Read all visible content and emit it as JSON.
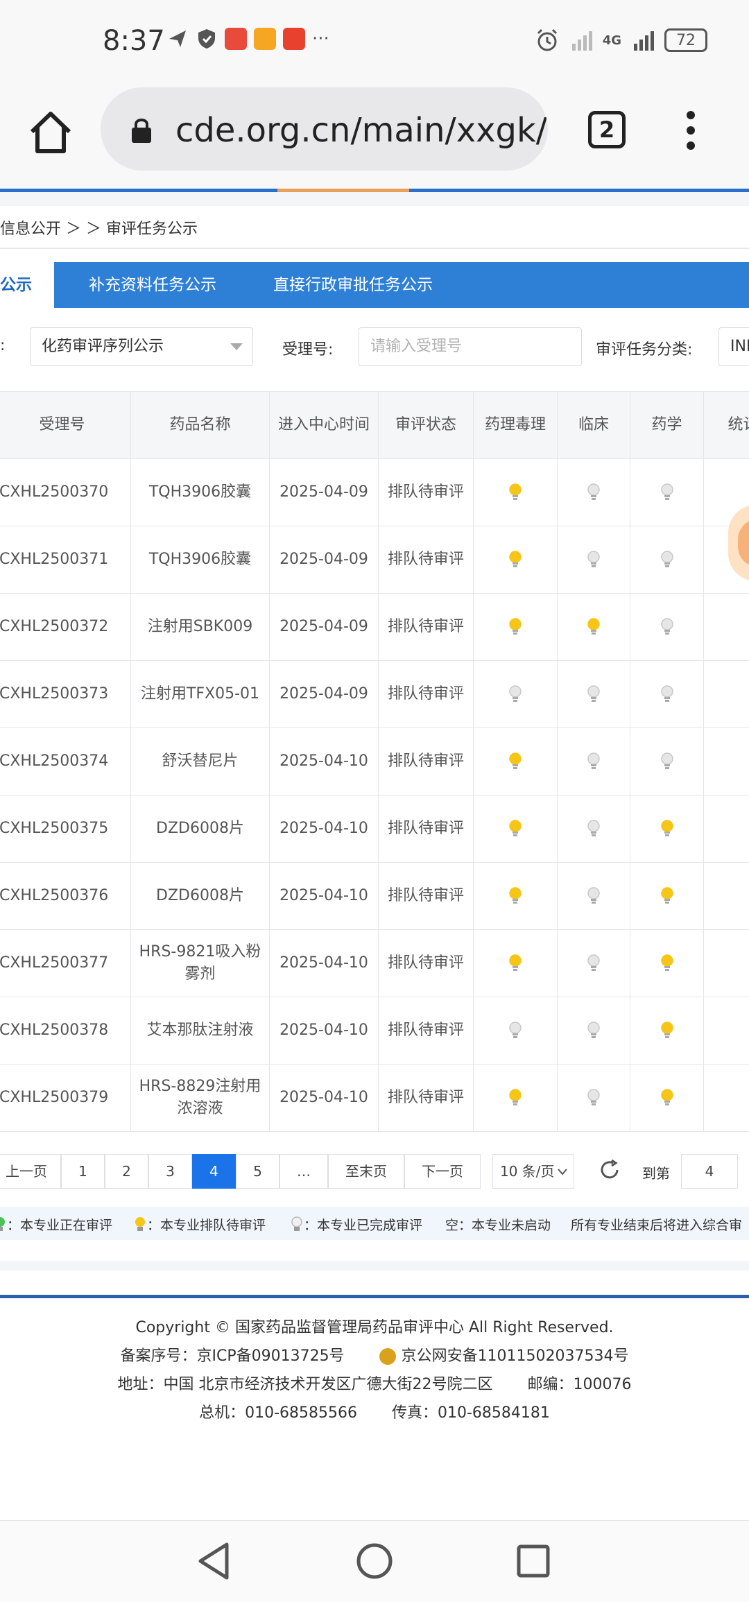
{
  "status": {
    "time": "8:37",
    "network": "4G",
    "battery": "72",
    "more": "···"
  },
  "browser": {
    "url": "cde.org.cn/main/xxgk/lis",
    "tab_count": "2"
  },
  "breadcrumb": "信息公开 ＞ ＞ 审评任务公示",
  "tabs": [
    {
      "label": "公示"
    },
    {
      "label": "补充资料任务公示"
    },
    {
      "label": "直接行政审批任务公示"
    }
  ],
  "filters": {
    "category_label": ":",
    "category_value": "化药审评序列公示",
    "accept_label": "受理号:",
    "accept_placeholder": "请输入受理号",
    "task_label": "审评任务分类:",
    "task_value": "INI"
  },
  "table": {
    "headers": [
      "受理号",
      "药品名称",
      "进入中心时间",
      "审评状态",
      "药理毒理",
      "临床",
      "药学",
      "统计"
    ],
    "rows": [
      {
        "id": "CXHL2500370",
        "name": "TQH3906胶囊",
        "date": "2025-04-09",
        "status": "排队待审评",
        "pharm": "yellow",
        "clinical": "white",
        "pharmacy": "white"
      },
      {
        "id": "CXHL2500371",
        "name": "TQH3906胶囊",
        "date": "2025-04-09",
        "status": "排队待审评",
        "pharm": "yellow",
        "clinical": "white",
        "pharmacy": "white"
      },
      {
        "id": "CXHL2500372",
        "name": "注射用SBK009",
        "date": "2025-04-09",
        "status": "排队待审评",
        "pharm": "yellow",
        "clinical": "yellow",
        "pharmacy": "white"
      },
      {
        "id": "CXHL2500373",
        "name": "注射用TFX05-01",
        "date": "2025-04-09",
        "status": "排队待审评",
        "pharm": "white",
        "clinical": "white",
        "pharmacy": "white"
      },
      {
        "id": "CXHL2500374",
        "name": "舒沃替尼片",
        "date": "2025-04-10",
        "status": "排队待审评",
        "pharm": "yellow",
        "clinical": "white",
        "pharmacy": "white"
      },
      {
        "id": "CXHL2500375",
        "name": "DZD6008片",
        "date": "2025-04-10",
        "status": "排队待审评",
        "pharm": "yellow",
        "clinical": "white",
        "pharmacy": "yellow"
      },
      {
        "id": "CXHL2500376",
        "name": "DZD6008片",
        "date": "2025-04-10",
        "status": "排队待审评",
        "pharm": "yellow",
        "clinical": "white",
        "pharmacy": "yellow"
      },
      {
        "id": "CXHL2500377",
        "name": "HRS-9821吸入粉雾剂",
        "date": "2025-04-10",
        "status": "排队待审评",
        "pharm": "yellow",
        "clinical": "white",
        "pharmacy": "yellow"
      },
      {
        "id": "CXHL2500378",
        "name": "艾本那肽注射液",
        "date": "2025-04-10",
        "status": "排队待审评",
        "pharm": "white",
        "clinical": "white",
        "pharmacy": "yellow"
      },
      {
        "id": "CXHL2500379",
        "name": "HRS-8829注射用浓溶液",
        "date": "2025-04-10",
        "status": "排队待审评",
        "pharm": "yellow",
        "clinical": "white",
        "pharmacy": "yellow"
      }
    ]
  },
  "pager": {
    "prev": "上一页",
    "pages": [
      "1",
      "2",
      "3",
      "4",
      "5",
      "…"
    ],
    "current": "4",
    "last": "至末页",
    "next": "下一页",
    "page_size": "10 条/页",
    "goto_label": "到第",
    "goto_value": "4"
  },
  "legend": {
    "green": "：本专业正在审评",
    "yellow": "：本专业排队待审评",
    "white": "：本专业已完成审评",
    "empty": "空：本专业未启动",
    "note": "所有专业结束后将进入综合审"
  },
  "footer": {
    "copyright": "Copyright © 国家药品监督管理局药品审评中心   All Right Reserved.",
    "icp": "备案序号：京ICP备09013725号",
    "police": "京公网安备11011502037534号",
    "address": "地址：中国 北京市经济技术开发区广德大街22号院二区",
    "postcode": "邮编：100076",
    "phone": "总机：010-68585566",
    "fax": "传真：010-68584181"
  },
  "colors": {
    "primary_blue": "#2e7fd6",
    "bulb_yellow": "#f5c518",
    "bulb_green": "#4cc15a",
    "bulb_white": "#e6e6e6"
  }
}
